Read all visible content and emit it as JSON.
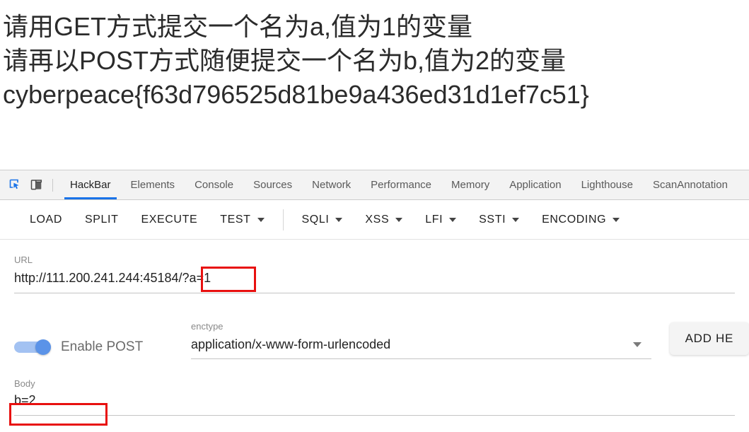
{
  "page": {
    "lines": [
      "请用GET方式提交一个名为a,值为1的变量",
      "请再以POST方式随便提交一个名为b,值为2的变量",
      "cyberpeace{f63d796525d81be9a436ed31d1ef7c51}"
    ]
  },
  "devtools": {
    "icons": {
      "inspect": "inspect-element-cursor-icon",
      "device": "device-toolbar-icon"
    },
    "tabs": [
      {
        "label": "HackBar",
        "active": true
      },
      {
        "label": "Elements",
        "active": false
      },
      {
        "label": "Console",
        "active": false
      },
      {
        "label": "Sources",
        "active": false
      },
      {
        "label": "Network",
        "active": false
      },
      {
        "label": "Performance",
        "active": false
      },
      {
        "label": "Memory",
        "active": false
      },
      {
        "label": "Application",
        "active": false
      },
      {
        "label": "Lighthouse",
        "active": false
      },
      {
        "label": "ScanAnnotation",
        "active": false
      }
    ],
    "accent_color": "#1a73e8"
  },
  "hackbar": {
    "toolbar": {
      "load": "LOAD",
      "split": "SPLIT",
      "execute": "EXECUTE",
      "test": "TEST",
      "sqli": "SQLI",
      "xss": "XSS",
      "lfi": "LFI",
      "ssti": "SSTI",
      "encoding": "ENCODING"
    },
    "url": {
      "label": "URL",
      "value": "http://111.200.241.244:45184/?a=1"
    },
    "post": {
      "toggle_label": "Enable POST",
      "toggle_on": true
    },
    "enctype": {
      "label": "enctype",
      "value": "application/x-www-form-urlencoded"
    },
    "add_header_button": "ADD HE",
    "body": {
      "label": "Body",
      "value": "b=2"
    }
  },
  "annotations": {
    "color": "#e8100f",
    "url_highlight": "/?a=1",
    "body_highlight": "b=2"
  }
}
